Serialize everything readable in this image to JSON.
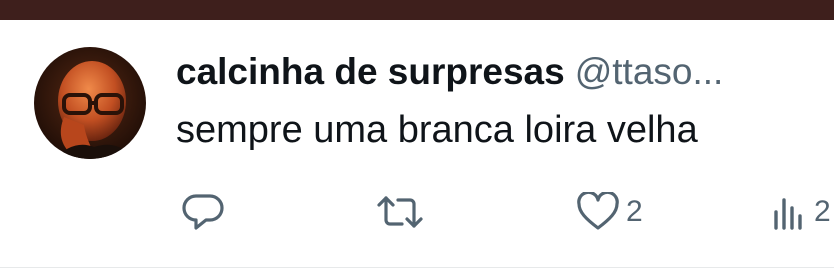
{
  "tweet": {
    "display_name": "calcinha de surpresas",
    "handle": "@ttaso...",
    "text": "sempre uma branca loira velha",
    "reply_count": "",
    "retweet_count": "",
    "like_count": "2",
    "views_count": "2"
  },
  "colors": {
    "top_bar": "#3e1f1c",
    "text": "#0f1419",
    "secondary": "#536471"
  },
  "icons": {
    "reply": "reply-icon",
    "retweet": "retweet-icon",
    "like": "heart-icon",
    "views": "views-icon"
  }
}
